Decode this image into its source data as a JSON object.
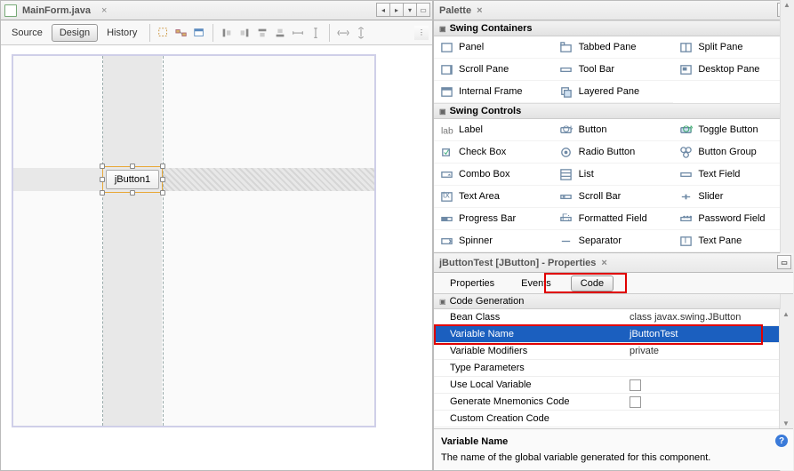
{
  "editor": {
    "filename": "MainForm.java",
    "views": {
      "source": "Source",
      "design": "Design",
      "history": "History",
      "active": "design"
    },
    "button_label": "jButton1"
  },
  "palette": {
    "title": "Palette",
    "sections": {
      "containers": {
        "label": "Swing Containers",
        "items": [
          "Panel",
          "Tabbed Pane",
          "Split Pane",
          "Scroll Pane",
          "Tool Bar",
          "Desktop Pane",
          "Internal Frame",
          "Layered Pane"
        ]
      },
      "controls": {
        "label": "Swing Controls",
        "items": [
          "Label",
          "Button",
          "Toggle Button",
          "Check Box",
          "Radio Button",
          "Button Group",
          "Combo Box",
          "List",
          "Text Field",
          "Text Area",
          "Scroll Bar",
          "Slider",
          "Progress Bar",
          "Formatted Field",
          "Password Field",
          "Spinner",
          "Separator",
          "Text Pane"
        ]
      }
    }
  },
  "properties": {
    "header": "jButtonTest [JButton] - Properties",
    "tabs": {
      "properties": "Properties",
      "events": "Events",
      "code": "Code"
    },
    "category": "Code Generation",
    "rows": [
      {
        "key": "Bean Class",
        "val": "class javax.swing.JButton",
        "btn": false
      },
      {
        "key": "Variable Name",
        "val": "jButtonTest",
        "btn": true,
        "selected": true
      },
      {
        "key": "Variable Modifiers",
        "val": "private",
        "btn": true
      },
      {
        "key": "Type Parameters",
        "val": "",
        "btn": true
      },
      {
        "key": "Use Local Variable",
        "val": "",
        "check": true
      },
      {
        "key": "Generate Mnemonics Code",
        "val": "",
        "check": true
      },
      {
        "key": "Custom Creation Code",
        "val": "",
        "btn": true
      }
    ],
    "footer": {
      "title": "Variable Name",
      "desc": "The name of the global variable generated for this component."
    }
  }
}
